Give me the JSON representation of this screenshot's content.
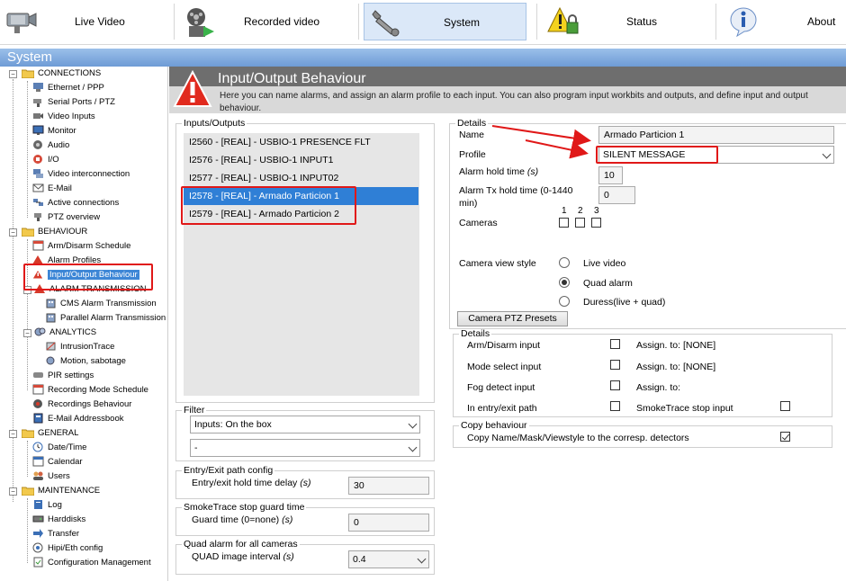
{
  "nav": {
    "live_video": "Live Video",
    "recorded_video": "Recorded video",
    "system": "System",
    "status": "Status",
    "about": "About"
  },
  "section_title": "System",
  "sidebar": {
    "connections": {
      "label": "CONNECTIONS",
      "items": [
        "Ethernet / PPP",
        "Serial Ports / PTZ",
        "Video Inputs",
        "Monitor",
        "Audio",
        "I/O",
        "Video interconnection",
        "E-Mail",
        "Active connections",
        "PTZ overview"
      ]
    },
    "behaviour": {
      "label": "BEHAVIOUR",
      "items": [
        "Arm/Disarm Schedule",
        "Alarm Profiles",
        "Input/Output Behaviour"
      ]
    },
    "alarm_transmission": {
      "label": "ALARM TRANSMISSION",
      "items": [
        "CMS Alarm Transmission",
        "Parallel Alarm Transmission"
      ]
    },
    "analytics": {
      "label": "ANALYTICS",
      "items": [
        "IntrusionTrace",
        "Motion, sabotage"
      ]
    },
    "misc": [
      "PIR settings",
      "Recording Mode Schedule",
      "Recordings Behaviour",
      "E-Mail Addressbook"
    ],
    "general": {
      "label": "GENERAL",
      "items": [
        "Date/Time",
        "Calendar",
        "Users"
      ]
    },
    "maintenance": {
      "label": "MAINTENANCE",
      "items": [
        "Log",
        "Harddisks",
        "Transfer",
        "Hipi/Eth config",
        "Configuration Management"
      ]
    }
  },
  "page": {
    "title": "Input/Output Behaviour",
    "description": "Here you can name alarms, and assign an alarm profile to each input. You can also program input workbits and outputs, and define input and output behaviour."
  },
  "io": {
    "legend": "Inputs/Outputs",
    "rows": [
      "I2560 - [REAL] - USBIO-1 PRESENCE FLT",
      "I2576 - [REAL] - USBIO-1 INPUT1",
      "I2577 - [REAL] - USBIO-1 INPUT02",
      "I2578 - [REAL] - Armado Particion 1",
      "I2579 - [REAL] - Armado Particion 2"
    ],
    "selected_index": 3
  },
  "filter": {
    "legend": "Filter",
    "option1": "Inputs: On the box",
    "option2": "-"
  },
  "entry_exit": {
    "legend": "Entry/Exit path config",
    "label_text": "Entry/exit hold time delay ",
    "unit": "(s)",
    "value": "30"
  },
  "smoketrace": {
    "legend": "SmokeTrace stop guard time",
    "label_text": "Guard time (0=none) ",
    "unit": "(s)",
    "value": "0"
  },
  "quad": {
    "legend": "Quad alarm for all cameras",
    "label_text": "QUAD image interval ",
    "unit": "(s)",
    "value": "0.4"
  },
  "details": {
    "legend": "Details",
    "name_label": "Name",
    "name_value": "Armado Particion 1",
    "profile_label": "Profile",
    "profile_value": "SILENT MESSAGE",
    "hold_label": "Alarm hold time ",
    "hold_unit": "(s)",
    "hold_value": "10",
    "tx_label": "Alarm Tx hold time (0-1440 min)",
    "tx_value": "0",
    "cameras_label": "Cameras",
    "camera_numbers": [
      "1",
      "2",
      "3"
    ],
    "view_style_label": "Camera view style",
    "view_options": [
      "Live video",
      "Quad alarm",
      "Duress(live + quad)"
    ],
    "view_selected": 1,
    "ptz_button": "Camera PTZ Presets"
  },
  "details2": {
    "legend": "Details",
    "rows": [
      {
        "label": "Arm/Disarm input",
        "assign": "Assign. to: [NONE]"
      },
      {
        "label": "Mode select input",
        "assign": "Assign. to: [NONE]"
      },
      {
        "label": "Fog detect input",
        "assign": "Assign. to:"
      },
      {
        "label": "In entry/exit path",
        "assign": "SmokeTrace stop input"
      }
    ]
  },
  "copy": {
    "legend": "Copy behaviour",
    "label": "Copy Name/Mask/Viewstyle to the corresp. detectors",
    "checked": true
  },
  "colors": {
    "selection": "#2f7fd6",
    "annotation": "#e01818",
    "header": "#6e9bd6"
  }
}
